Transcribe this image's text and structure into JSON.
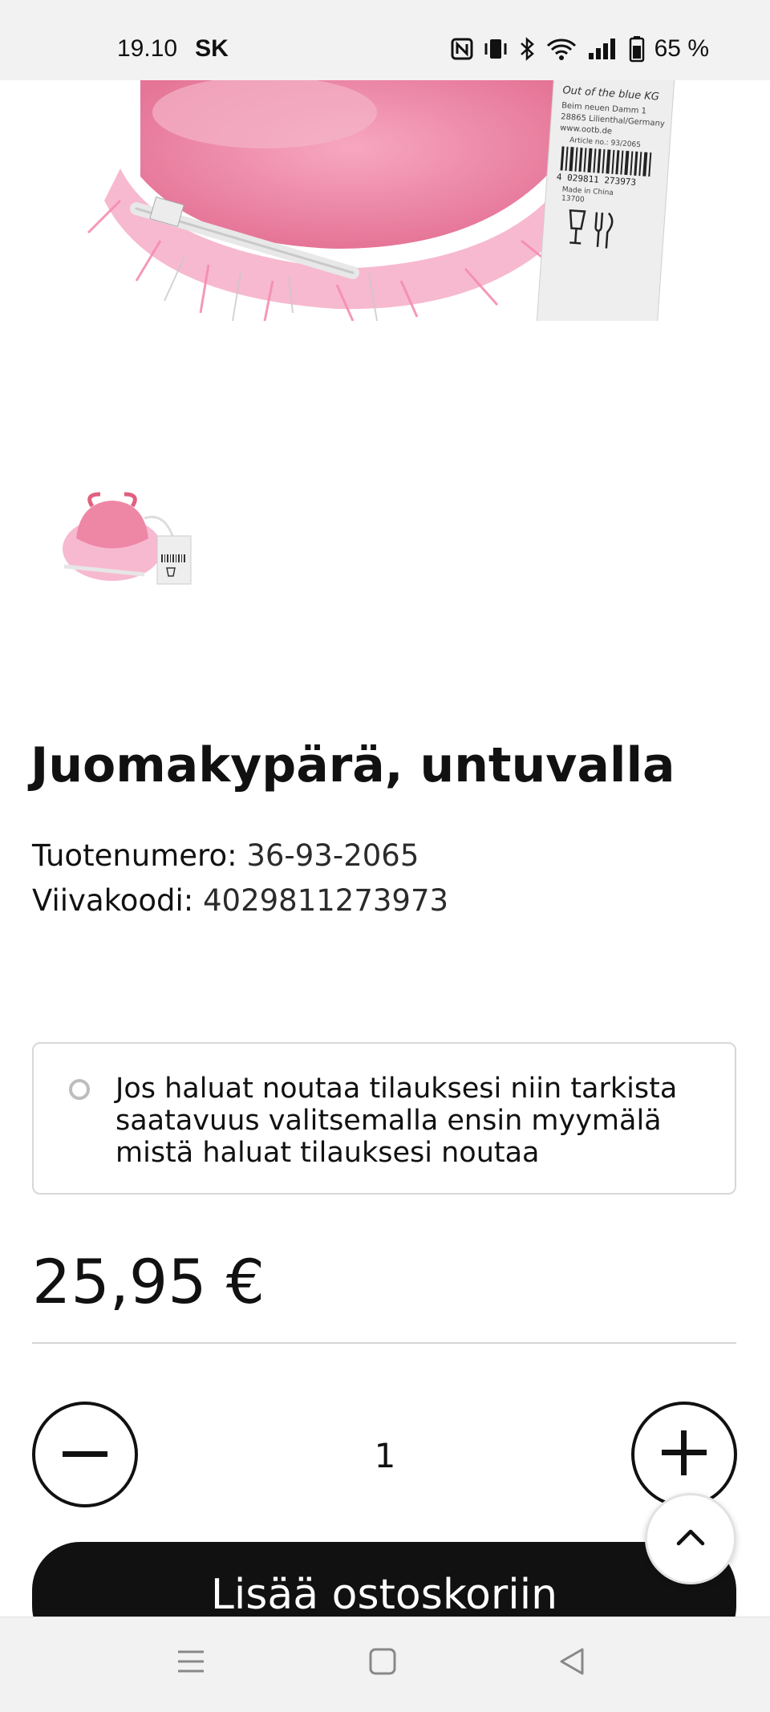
{
  "status_bar": {
    "time": "19.10",
    "carrier": "SK",
    "battery": "65 %"
  },
  "product": {
    "title": "Juomakypärä, untuvalla",
    "sku_label": "Tuotenumero:",
    "sku": "36-93-2065",
    "barcode_label": "Viivakoodi:",
    "barcode": "4029811273973",
    "pickup_notice": "Jos haluat noutaa tilauksesi niin tarkista saatavuus valitsemalla ensin myymälä mistä haluat tilauksesi noutaa",
    "price": "25,95 €",
    "quantity": "1",
    "add_to_cart_label": "Lisää ostoskoriin"
  },
  "product_image": {
    "label_brand": "Out of the blue KG",
    "label_address_1": "Beim neuen Damm 1",
    "label_address_2": "28865 Lilienthal/Germany",
    "label_web": "www.ootb.de",
    "label_article": "Article no.: 93/2065",
    "label_barcode": "4 029811 273973",
    "label_origin": "Made in China",
    "label_code": "13700"
  },
  "colors": {
    "accent": "#111111",
    "helmet_pink": "#f08aa8",
    "fluff_pink": "#f7b9cf",
    "border": "#d7d7d7"
  },
  "icons": {
    "status": [
      "nfc-icon",
      "vibrate-icon",
      "bluetooth-icon",
      "wifi-icon",
      "signal-icon",
      "battery-icon"
    ],
    "nav": [
      "menu-icon",
      "home-icon",
      "back-icon"
    ],
    "controls": [
      "minus-icon",
      "plus-icon",
      "chevron-up-icon",
      "radio-icon"
    ]
  }
}
